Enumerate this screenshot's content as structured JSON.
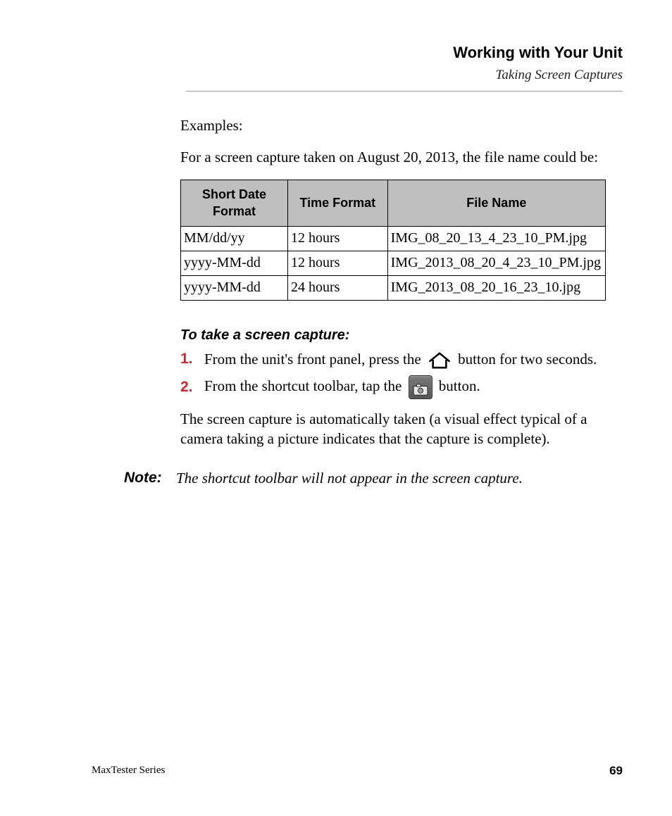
{
  "header": {
    "title": "Working with Your Unit",
    "subtitle": "Taking Screen Captures"
  },
  "intro": {
    "examples_label": "Examples:",
    "lead_in": "For a screen capture taken on August 20, 2013, the file name could be:"
  },
  "table": {
    "headers": {
      "col1": "Short Date Format",
      "col2": "Time Format",
      "col3": "File Name"
    },
    "rows": [
      {
        "short": "MM/dd/yy",
        "time": "12 hours",
        "file": "IMG_08_20_13_4_23_10_PM.jpg"
      },
      {
        "short": "yyyy-MM-dd",
        "time": "12 hours",
        "file": "IMG_2013_08_20_4_23_10_PM.jpg"
      },
      {
        "short": "yyyy-MM-dd",
        "time": "24 hours",
        "file": "IMG_2013_08_20_16_23_10.jpg"
      }
    ]
  },
  "procedure": {
    "heading": "To take a screen capture:",
    "step1_num": "1.",
    "step1_a": "From the unit's front panel, press the ",
    "step1_b": " button for two seconds.",
    "step2_num": "2.",
    "step2_a": "From the shortcut toolbar, tap the ",
    "step2_b": " button.",
    "result": "The screen capture is automatically taken (a visual effect typical of a camera taking a picture indicates that the capture is complete)."
  },
  "note": {
    "label": "Note:",
    "text": "The shortcut toolbar will not appear in the screen capture."
  },
  "footer": {
    "left": "MaxTester Series",
    "right": "69"
  }
}
